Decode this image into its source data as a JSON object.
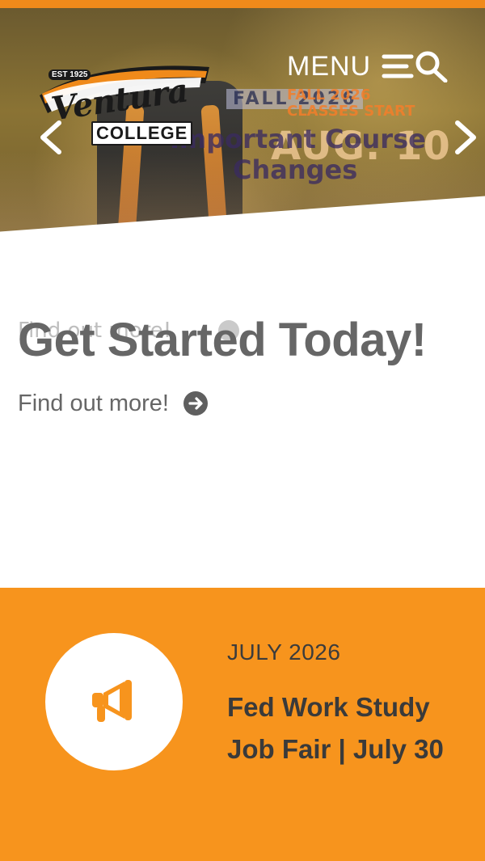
{
  "header": {
    "logo": {
      "est_text": "EST 1925",
      "title": "Ventura",
      "subtitle": "COLLEGE"
    },
    "menu_label": "MENU",
    "icons": [
      "hamburger-icon",
      "search-icon",
      "chevron-left-icon",
      "chevron-right-icon"
    ]
  },
  "hero": {
    "slide_course": {
      "line1": "Important Course",
      "line2": "Changes"
    },
    "slide_fall": {
      "badge": "FALL 2026",
      "top_line1": "FALL 2026",
      "top_line2": "CLASSES START",
      "date": "AUG. 10"
    }
  },
  "cta": {
    "ghost_link": "Find out more!",
    "heading": "Get Started Today!",
    "link_label": "Find out more!"
  },
  "news": {
    "icon": "megaphone-icon",
    "date": "JULY 2026",
    "title": "Fed Work Study Job Fair | July 30"
  },
  "colors": {
    "accent_orange": "#f7941d",
    "top_bar": "#f08a1a",
    "text_gray": "#666666",
    "dark_text": "#3a3a3a"
  }
}
